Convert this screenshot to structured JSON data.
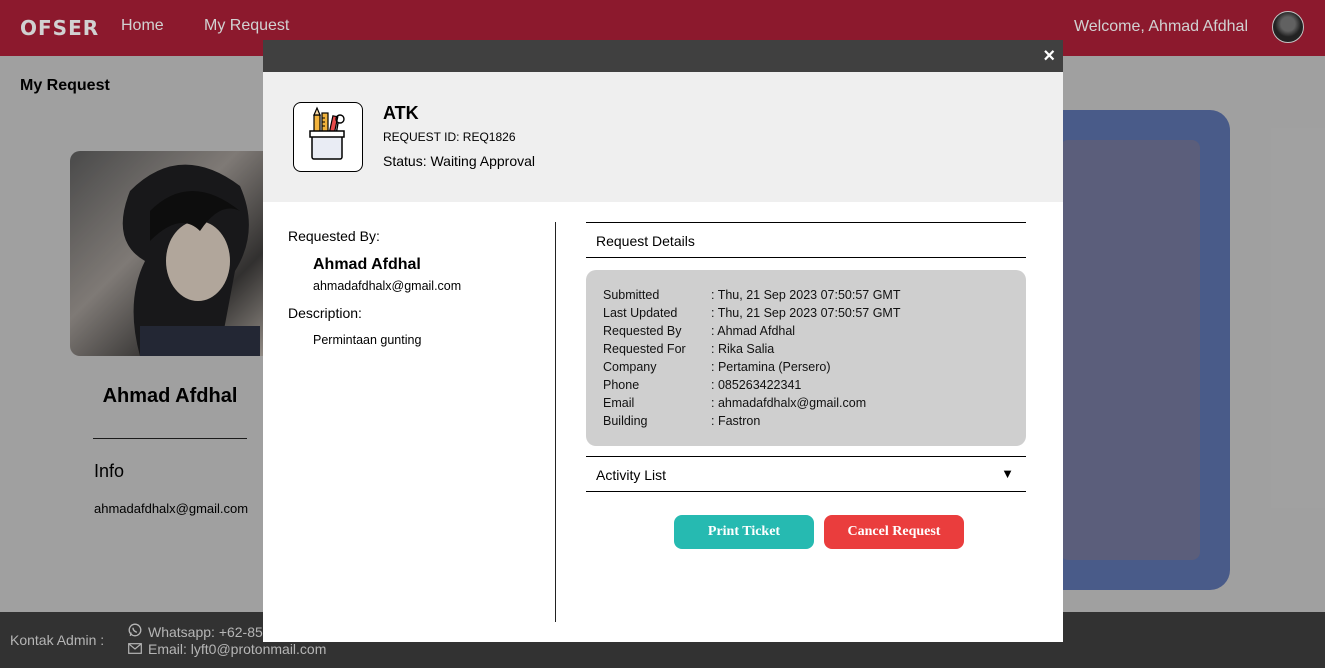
{
  "nav": {
    "brand": "OFSER",
    "home": "Home",
    "my_request": "My Request",
    "welcome": "Welcome, Ahmad Afdhal"
  },
  "page": {
    "title": "My Request"
  },
  "profile": {
    "name": "Ahmad Afdhal",
    "info_title": "Info",
    "email": "ahmadafdhalx@gmail.com"
  },
  "footer": {
    "label": "Kontak Admin :",
    "whatsapp": "Whatsapp: +62-85",
    "email": "Email: lyft0@protonmail.com"
  },
  "modal": {
    "close": "×",
    "title": "ATK",
    "request_id": "REQUEST ID: REQ1826",
    "status": "Status: Waiting Approval",
    "requested_by_label": "Requested By:",
    "requested_by_name": "Ahmad Afdhal",
    "requested_by_email": "ahmadafdhalx@gmail.com",
    "description_label": "Description:",
    "description_text": "Permintaan gunting",
    "request_details_label": "Request Details",
    "details": [
      {
        "key": "Submitted",
        "value": ": Thu, 21 Sep 2023 07:50:57 GMT"
      },
      {
        "key": "Last Updated",
        "value": ": Thu, 21 Sep 2023 07:50:57 GMT"
      },
      {
        "key": "Requested By",
        "value": ": Ahmad Afdhal"
      },
      {
        "key": "Requested For",
        "value": ": Rika Salia"
      },
      {
        "key": "Company",
        "value": ": Pertamina (Persero)"
      },
      {
        "key": "Phone",
        "value": ": 085263422341"
      },
      {
        "key": "Email",
        "value": ": ahmadafdhalx@gmail.com"
      },
      {
        "key": "Building",
        "value": ": Fastron"
      }
    ],
    "activity_list_label": "Activity List",
    "activity_caret": "▼",
    "print_button": "Print Ticket",
    "cancel_button": "Cancel Request"
  },
  "colors": {
    "navbar": "#ab1f38",
    "print": "#26bab1",
    "cancel": "#ea3d3d"
  },
  "icons": {
    "modal_item": "stationery-cup-icon",
    "whatsapp": "whatsapp-icon",
    "email": "envelope-icon"
  }
}
